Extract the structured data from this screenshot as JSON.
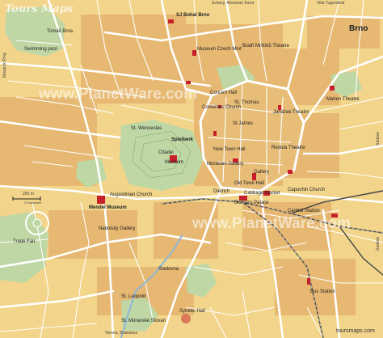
{
  "map": {
    "watermark_logo": "Tours Maps",
    "title": "Brno",
    "watermarks": [
      "www.PlanetWare.com",
      "www.PlanetWare.com"
    ],
    "credit": "toursmaps.com",
    "scale_label": "250 m",
    "scale_copyright": "© Baedeker",
    "colors": {
      "land": "#f2d58a",
      "built": "#e3b46a",
      "park": "#bfd7a4",
      "road": "#ffffff",
      "rail": "#444444",
      "poi": "#c8202a"
    },
    "edge_labels": {
      "top_center": "Svitavy, Moravian Karst",
      "top_right": "Villa Tugendhat",
      "left_top": "Masaryk Ring",
      "bottom_center": "Vienna, Bratislava",
      "right_upper": "Sadová",
      "right_lower": "Sadová"
    },
    "places": [
      "Tomáš Brna",
      "Swimming pool",
      "SJ Bohal Brno",
      "Museum Czech Mint",
      "Bratři Mrštíků Theatre",
      "Concert Hall",
      "St. Thomas",
      "Comenius Church",
      "Spielberk",
      "Citadel",
      "Museum",
      "St. Wenceslas",
      "St James",
      "Moravian Gallery",
      "New Town Hall",
      "Gallery",
      "Old Town Hall",
      "Cabbage Market",
      "Capuchin Church",
      "Bishop's Palace",
      "Mendel Museum",
      "Augustinian Church",
      "Dietrich",
      "Reduta Theatre",
      "Janáček Theatre",
      "Central Station",
      "Bus Station",
      "Nabolský Gallery",
      "Mahen Theatre",
      "Trade Fair",
      "Synetic Hall",
      "St. Leopold",
      "St. Moravské Slovan",
      "Sladovna"
    ]
  }
}
